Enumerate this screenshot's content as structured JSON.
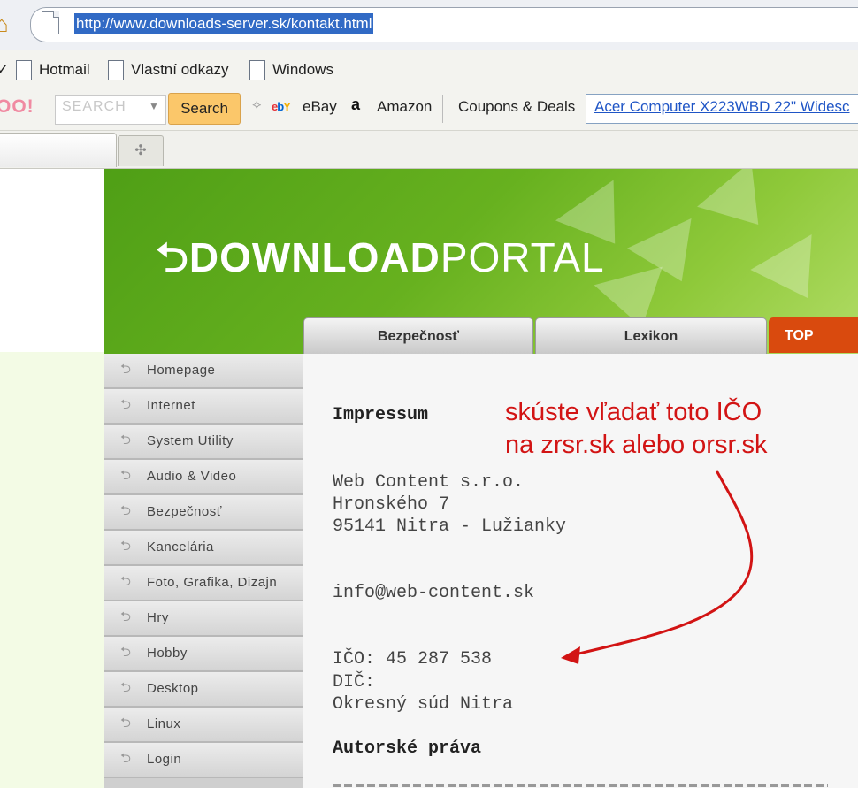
{
  "browser": {
    "url": "http://www.downloads-server.sk/kontakt.html",
    "bookmarks": [
      "Hotmail",
      "Vlastní odkazy",
      "Windows"
    ],
    "toolbar": {
      "yahoo_logo": "OO!",
      "search_placeholder": "SEARCH",
      "search_button": "Search",
      "ebay_label": "eBay",
      "ebay_logo": "ebY",
      "amazon_label": "Amazon",
      "amazon_logo": "a",
      "coupons_label": "Coupons & Deals",
      "ad_link": "Acer Computer X223WBD 22\" Widesc"
    },
    "new_tab_icon": "plus-icon"
  },
  "site": {
    "logo": {
      "bold": "DOWNLOAD",
      "thin": "PORTAL"
    },
    "top_tabs": [
      "Bezpečnosť",
      "Lexikon",
      "TOP"
    ],
    "menu": [
      "Homepage",
      "Internet",
      "System Utility",
      "Audio & Video",
      "Bezpečnosť",
      "Kancelária",
      "Foto, Grafika, Dizajn",
      "Hry",
      "Hobby",
      "Desktop",
      "Linux",
      "Login"
    ],
    "content": {
      "heading": "Impressum",
      "company_lines": [
        "Web Content s.r.o.",
        "Hronského 7",
        "95141 Nitra - Lužianky"
      ],
      "email": "info@web-content.sk",
      "ico": "IČO: 45 287 538",
      "dic": "DIČ:",
      "court": "Okresný súd Nitra",
      "section2": "Autorské práva",
      "annotation": [
        "skúste vľadať toto IČO",
        "na zrsr.sk alebo orsr.sk"
      ]
    }
  },
  "colors": {
    "banner_green": "#67b11f",
    "top_tab_orange": "#d94a0e",
    "annotation_red": "#d21414",
    "url_highlight": "#316ac5"
  }
}
